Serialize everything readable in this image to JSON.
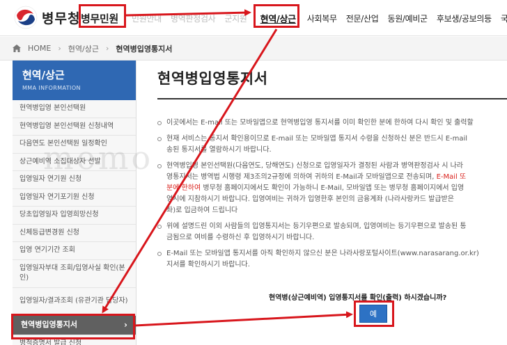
{
  "header": {
    "logo_text": "병무청",
    "nav": [
      {
        "label": "병무민원",
        "style": "main"
      },
      {
        "label": "민원안내",
        "style": "faded"
      },
      {
        "label": "병역판정검사",
        "style": "faded"
      },
      {
        "label": "군지원",
        "style": "faded"
      },
      {
        "label": "현역/상근",
        "style": "active"
      },
      {
        "label": "사회복무",
        "style": "normal"
      },
      {
        "label": "전문/산업",
        "style": "normal"
      },
      {
        "label": "동원/예비군",
        "style": "normal"
      },
      {
        "label": "후보생/공보의등",
        "style": "normal"
      },
      {
        "label": "국외",
        "style": "normal"
      }
    ]
  },
  "breadcrumb": {
    "home": "HOME",
    "level1": "현역/상근",
    "current": "현역병입영통지서"
  },
  "sidebar": {
    "title": "현역/상근",
    "subtitle": "MMA INFORMATION",
    "items": [
      {
        "label": "현역병입영 본인선택원",
        "size": "h26"
      },
      {
        "label": "현역병입영 본인선택원 신청내역",
        "size": "h26"
      },
      {
        "label": "다음연도 본인선택원 일정확인",
        "size": "h26"
      },
      {
        "label": "상근예비역 소집대상자 선발",
        "size": "h26"
      },
      {
        "label": "입영일자 연기원 신청",
        "size": "h26"
      },
      {
        "label": "입영일자 연기포기원 신청",
        "size": "h26"
      },
      {
        "label": "당초입영일자 입영희망신청",
        "size": "h26"
      },
      {
        "label": "신체등급변경원 신청",
        "size": "h26"
      },
      {
        "label": "입영 연기기간 조회",
        "size": "h26"
      },
      {
        "label": "입영일자부대 조회/입영사실 확인(본인)",
        "size": "h40"
      },
      {
        "label": "입영일자/결과조회 (유관기관 담당자)",
        "size": "h40"
      },
      {
        "label": "현역병입영통지서",
        "size": "active"
      },
      {
        "label": "병적증명서 발급 신청",
        "size": "h26"
      }
    ],
    "active_chevron": "›"
  },
  "main": {
    "title": "현역병입영통지서",
    "notices": [
      {
        "lines": [
          [
            {
              "t": "이곳에서는 E-mail 또는 모바일앱으로 현역병입영 통지서를 이미 확인한 분에 한하여 다시 확인 및 출력할"
            }
          ]
        ]
      },
      {
        "lines": [
          [
            {
              "t": "현재 서비스는 통지서 확인용이므로 E-mail 또는 모바일앱 통지서 수령을 신청하신 분은 반드시 E-mail"
            }
          ],
          [
            {
              "t": "송된 통지서를 열람하시기 바랍니다."
            }
          ]
        ]
      },
      {
        "lines": [
          [
            {
              "t": "현역병입영 본인선택원(다음연도, 당해연도) 신청으로 입영일자가 결정된 사람과 병역판정검사 시 나라"
            }
          ],
          [
            {
              "t": "영통지서는 병역법 시행령 제3조의2규정에 의하여 귀하의 E-Mail과 모바일앱으로 전송되며, "
            },
            {
              "t": "E-Mail 또",
              "red": true
            }
          ],
          [
            {
              "t": "분에 한하여",
              "red": true
            },
            {
              "t": " 병무청 홈페이지에서도 확인이 가능하니 E-Mail, 모바일앱 또는 병무청 홈페이지에서 입영"
            }
          ],
          [
            {
              "t": "영시에 지참하시기 바랍니다. 입영여비는 귀하가 입영한후 본인의 금융계좌 (나라사랑카드 발급받은 "
            }
          ],
          [
            {
              "t": "좌)로 입금하여 드립니다"
            }
          ]
        ]
      },
      {
        "lines": [
          [
            {
              "t": "위에 설명드린 이외 사람들의 입영통지서는 등기우편으로 발송되며, 입영여비는 등기우편으로 발송된 통"
            }
          ],
          [
            {
              "t": "금됨으로 여비를 수령하신 후 입영하시기 바랍니다."
            }
          ]
        ]
      },
      {
        "lines": [
          [
            {
              "t": "E-Mail 또는 모바일앱 통지서를 아직 확인하지 않으신 분은 나라사랑포털사이트(www.narasarang.or.kr)"
            }
          ],
          [
            {
              "t": "지서를 확인하시기 바랍니다."
            }
          ]
        ]
      }
    ],
    "question": "현역병(상근예비역) 입영통지서를 확인(출력) 하시겠습니까?",
    "yes_button": "예"
  },
  "watermark": "memo",
  "colors": {
    "accent_blue": "#2f68b3",
    "button_blue": "#2d72c4",
    "annotation_red": "#d8161c",
    "sidebar_active": "#606060",
    "notice_red": "#d9201b"
  }
}
